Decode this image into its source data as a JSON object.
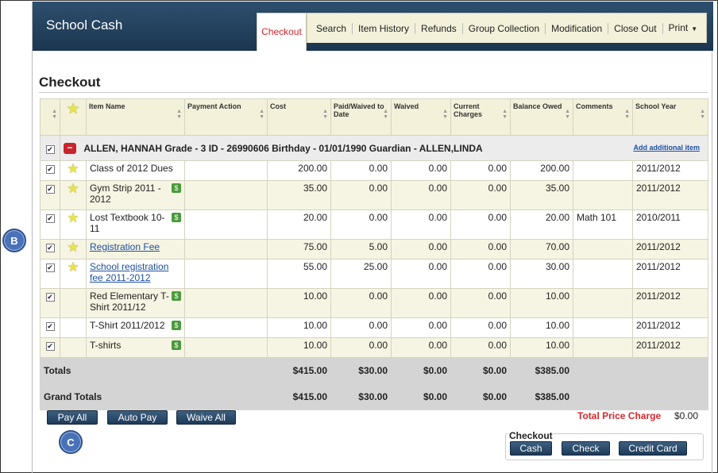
{
  "app": {
    "title": "School Cash"
  },
  "nav": {
    "active_tab": "Checkout",
    "tabs": [
      "Search",
      "Item History",
      "Refunds",
      "Group Collection",
      "Modification",
      "Close Out",
      "Print"
    ]
  },
  "page_title": "Checkout",
  "table": {
    "headers": {
      "item_name": "Item Name",
      "payment_action": "Payment Action",
      "cost": "Cost",
      "paid_waived": "Paid/Waived to Date",
      "waived": "Waived",
      "current_charges": "Current Charges",
      "balance_owed": "Balance Owed",
      "comments": "Comments",
      "school_year": "School Year"
    },
    "student": {
      "info": "ALLEN, HANNAH Grade - 3 ID - 26990606 Birthday - 01/01/1990 Guardian - ALLEN,LINDA",
      "add_item": "Add additional item"
    },
    "rows": [
      {
        "item": "Class of 2012 Dues",
        "cost": "200.00",
        "paid": "0.00",
        "waived": "0.00",
        "current": "0.00",
        "balance": "200.00",
        "comments": "",
        "year": "2011/2012"
      },
      {
        "item": "Gym Strip 2011 - 2012",
        "cost": "35.00",
        "paid": "0.00",
        "waived": "0.00",
        "current": "0.00",
        "balance": "35.00",
        "comments": "",
        "year": "2011/2012"
      },
      {
        "item": "Lost Textbook 10-11",
        "cost": "20.00",
        "paid": "0.00",
        "waived": "0.00",
        "current": "0.00",
        "balance": "20.00",
        "comments": "Math 101",
        "year": "2010/2011"
      },
      {
        "item": "Registration Fee",
        "cost": "75.00",
        "paid": "5.00",
        "waived": "0.00",
        "current": "0.00",
        "balance": "70.00",
        "comments": "",
        "year": "2011/2012"
      },
      {
        "item": "School registration fee 2011-2012",
        "cost": "55.00",
        "paid": "25.00",
        "waived": "0.00",
        "current": "0.00",
        "balance": "30.00",
        "comments": "",
        "year": "2011/2012"
      },
      {
        "item": "Red Elementary T-Shirt 2011/12",
        "cost": "10.00",
        "paid": "0.00",
        "waived": "0.00",
        "current": "0.00",
        "balance": "10.00",
        "comments": "",
        "year": "2011/2012"
      },
      {
        "item": "T-Shirt 2011/2012",
        "cost": "10.00",
        "paid": "0.00",
        "waived": "0.00",
        "current": "0.00",
        "balance": "10.00",
        "comments": "",
        "year": "2011/2012"
      },
      {
        "item": "T-shirts",
        "cost": "10.00",
        "paid": "0.00",
        "waived": "0.00",
        "current": "0.00",
        "balance": "10.00",
        "comments": "",
        "year": "2011/2012"
      }
    ],
    "totals": {
      "label": "Totals",
      "cost": "$415.00",
      "paid": "$30.00",
      "waived": "$0.00",
      "current": "$0.00",
      "balance": "$385.00"
    },
    "grand_totals": {
      "label": "Grand Totals",
      "cost": "$415.00",
      "paid": "$30.00",
      "waived": "$0.00",
      "current": "$0.00",
      "balance": "$385.00"
    }
  },
  "actions": {
    "pay_all": "Pay All",
    "auto_pay": "Auto Pay",
    "waive_all": "Waive All"
  },
  "summary": {
    "total_price_label": "Total Price Charge",
    "total_price_value": "$0.00"
  },
  "checkout": {
    "label": "Checkout",
    "cash": "Cash",
    "check": "Check",
    "credit_card": "Credit Card"
  },
  "callouts": {
    "b": "B",
    "c": "C"
  },
  "colors": {
    "header": "#1c3650",
    "active_tab_text": "#d9272e",
    "tab_strip": "#f3f1da",
    "button": "#2a4a6b",
    "link": "#1f4fa0"
  }
}
